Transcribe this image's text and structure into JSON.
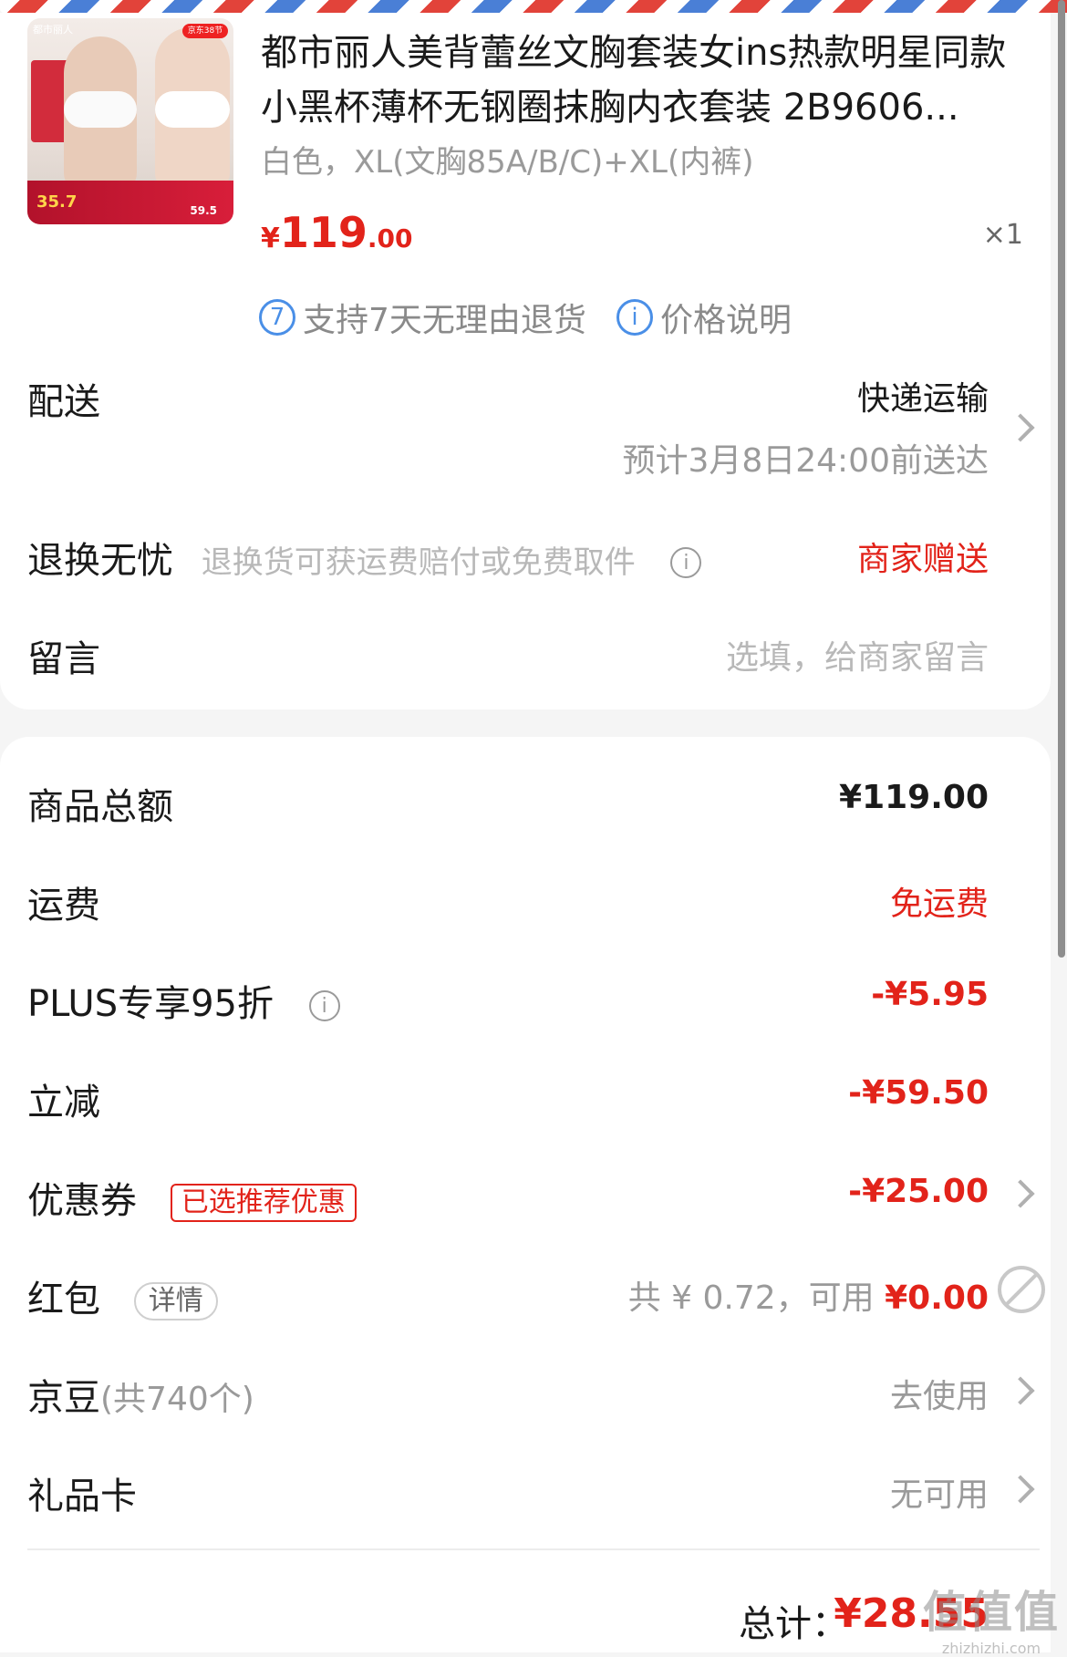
{
  "product": {
    "title": "都市丽人美背蕾丝文胸套装女ins热款明星同款小黑杯薄杯无钢圈抹胸内衣套装 2B9606...",
    "spec": "白色，XL(文胸85A/B/C)+XL(内裤)",
    "price_symbol": "¥",
    "price_int": "119",
    "price_dec": ".00",
    "quantity": "×1",
    "thumb": {
      "brand": "都市丽人",
      "badge": "京东38节",
      "promo_price": "35.7",
      "promo_price2": "59.5"
    }
  },
  "services": [
    {
      "icon": "seven-day-return-icon",
      "icon_text": "7",
      "label": "支持7天无理由退货"
    },
    {
      "icon": "info-icon",
      "icon_text": "i",
      "label": "价格说明"
    }
  ],
  "delivery": {
    "label": "配送",
    "method": "快递运输",
    "eta": "预计3月8日24:00前送达"
  },
  "return_worry_free": {
    "label": "退换无忧",
    "desc": "退换货可获运费赔付或免费取件",
    "value": "商家赠送"
  },
  "message": {
    "label": "留言",
    "placeholder": "选填，给商家留言"
  },
  "summary": {
    "goods_total_label": "商品总额",
    "goods_total": "¥119.00",
    "shipping_label": "运费",
    "shipping": "免运费",
    "plus_label": "PLUS专享95折",
    "plus_discount": "-¥5.95",
    "instant_label": "立减",
    "instant_discount": "-¥59.50",
    "coupon_label": "优惠券",
    "coupon_tag": "已选推荐优惠",
    "coupon_discount": "-¥25.00",
    "redpacket_label": "红包",
    "redpacket_tag": "详情",
    "redpacket_total": "共 ¥ 0.72，可用 ",
    "redpacket_available": "¥0.00",
    "jingdou_label": "京豆",
    "jingdou_count": "(共740个)",
    "jingdou_action": "去使用",
    "giftcard_label": "礼品卡",
    "giftcard_value": "无可用",
    "total_label": "总计：",
    "total_value": "¥28.55"
  },
  "watermark": {
    "line1": "值值值",
    "line2": "zhizhizhi.com"
  },
  "colors": {
    "accent_red": "#e2231a",
    "info_blue": "#4a8fe7"
  }
}
